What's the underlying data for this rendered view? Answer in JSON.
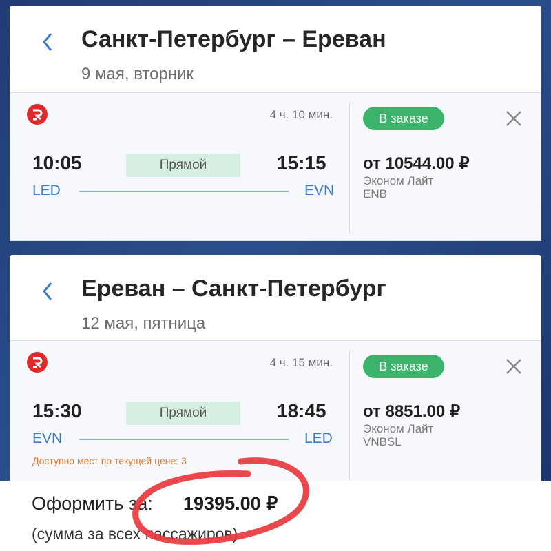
{
  "flights": [
    {
      "route": "Санкт-Петербург – Ереван",
      "date": "9 мая, вторник",
      "duration": "4 ч. 10 мин.",
      "departure_time": "10:05",
      "arrival_time": "15:15",
      "type": "Прямой",
      "from": "LED",
      "to": "EVN",
      "status": "В заказе",
      "price": "от 10544.00 ₽",
      "fare_class": "Эконом Лайт",
      "fare_code": "ENB",
      "seats_note": ""
    },
    {
      "route": "Ереван – Санкт-Петербург",
      "date": "12 мая, пятница",
      "duration": "4 ч. 15 мин.",
      "departure_time": "15:30",
      "arrival_time": "18:45",
      "type": "Прямой",
      "from": "EVN",
      "to": "LED",
      "status": "В заказе",
      "price": "от 8851.00 ₽",
      "fare_class": "Эконом Лайт",
      "fare_code": "VNBSL",
      "seats_note": "Доступно мест по текущей цене: 3"
    }
  ],
  "checkout": {
    "label": "Оформить за:",
    "total": "19395.00 ₽",
    "note": "(сумма за всех пассажиров)"
  },
  "icons": {
    "back": "chevron-left-icon",
    "airline": "airline-logo-icon",
    "close": "close-icon"
  },
  "colors": {
    "accent_blue": "#3a7ac9",
    "status_green": "#3bb36a",
    "direct_badge": "#d6efe0",
    "warning_orange": "#e07a2e",
    "annotation_red": "#e8383d"
  }
}
